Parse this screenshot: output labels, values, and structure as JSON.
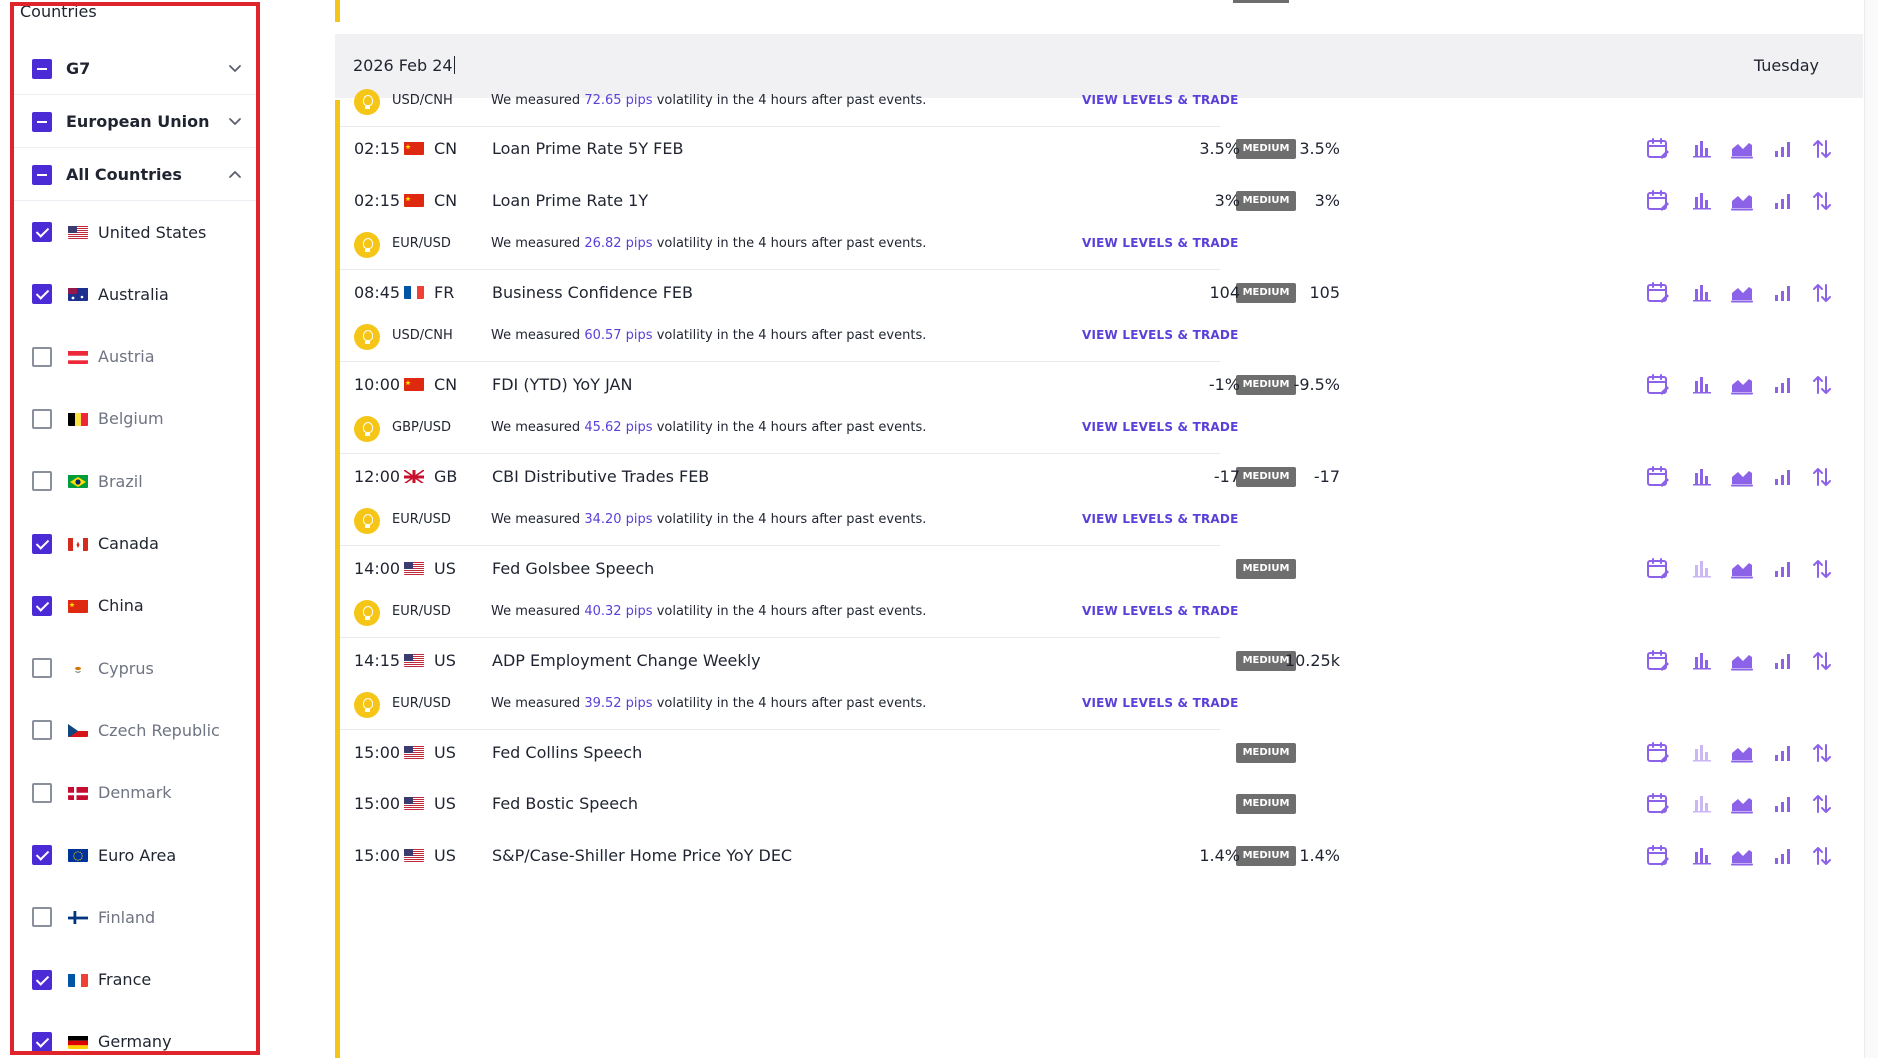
{
  "sidebar": {
    "title": "Countries",
    "groups": [
      {
        "label": "G7",
        "state": "partial",
        "chevron": "chevron-down-icon"
      },
      {
        "label": "European Union",
        "state": "partial",
        "chevron": "chevron-down-icon"
      },
      {
        "label": "All Countries",
        "state": "partial",
        "chevron": "chevron-up-icon"
      }
    ],
    "countries": [
      {
        "label": "United States",
        "checked": true,
        "flag": "us-flag-icon"
      },
      {
        "label": "Australia",
        "checked": true,
        "flag": "au-flag-icon"
      },
      {
        "label": "Austria",
        "checked": false,
        "flag": "at-flag-icon"
      },
      {
        "label": "Belgium",
        "checked": false,
        "flag": "be-flag-icon"
      },
      {
        "label": "Brazil",
        "checked": false,
        "flag": "br-flag-icon"
      },
      {
        "label": "Canada",
        "checked": true,
        "flag": "ca-flag-icon"
      },
      {
        "label": "China",
        "checked": true,
        "flag": "cn-flag-icon"
      },
      {
        "label": "Cyprus",
        "checked": false,
        "flag": "cy-flag-icon"
      },
      {
        "label": "Czech Republic",
        "checked": false,
        "flag": "cz-flag-icon"
      },
      {
        "label": "Denmark",
        "checked": false,
        "flag": "dk-flag-icon"
      },
      {
        "label": "Euro Area",
        "checked": true,
        "flag": "eu-flag-icon"
      },
      {
        "label": "Finland",
        "checked": false,
        "flag": "fi-flag-icon"
      },
      {
        "label": "France",
        "checked": true,
        "flag": "fr-flag-icon"
      },
      {
        "label": "Germany",
        "checked": true,
        "flag": "de-flag-icon"
      }
    ]
  },
  "calendar": {
    "date": "2026 Feb 24",
    "day": "Tuesday",
    "badge_label": "MEDIUM",
    "view_label": "VIEW LEVELS & TRADE",
    "vol_prefix": "We measured",
    "vol_suffix": "volatility in the 4 hours after past events.",
    "accent": "#5a3fd8",
    "highlight": "#f5c518",
    "rows": [
      {
        "kind": "info",
        "pair": "USD/CNH",
        "pips": "72.65 pips"
      },
      {
        "kind": "event",
        "time": "02:15",
        "country": "CN",
        "flag": "cn-flag-icon",
        "name": "Loan Prime Rate 5Y FEB",
        "actual": "3.5%",
        "previous": "3.5%",
        "bars_faded": false
      },
      {
        "kind": "event",
        "time": "02:15",
        "country": "CN",
        "flag": "cn-flag-icon",
        "name": "Loan Prime Rate 1Y",
        "actual": "3%",
        "previous": "3%",
        "bars_faded": false
      },
      {
        "kind": "info",
        "pair": "EUR/USD",
        "pips": "26.82 pips"
      },
      {
        "kind": "event",
        "time": "08:45",
        "country": "FR",
        "flag": "fr-flag-icon",
        "name": "Business Confidence FEB",
        "actual": "104",
        "previous": "105",
        "bars_faded": false
      },
      {
        "kind": "info",
        "pair": "USD/CNH",
        "pips": "60.57 pips"
      },
      {
        "kind": "event",
        "time": "10:00",
        "country": "CN",
        "flag": "cn-flag-icon",
        "name": "FDI (YTD) YoY JAN",
        "actual": "-1%",
        "previous": "-9.5%",
        "bars_faded": false
      },
      {
        "kind": "info",
        "pair": "GBP/USD",
        "pips": "45.62 pips"
      },
      {
        "kind": "event",
        "time": "12:00",
        "country": "GB",
        "flag": "gb-flag-icon",
        "name": "CBI Distributive Trades FEB",
        "actual": "-17",
        "previous": "-17",
        "bars_faded": false
      },
      {
        "kind": "info",
        "pair": "EUR/USD",
        "pips": "34.20 pips"
      },
      {
        "kind": "event",
        "time": "14:00",
        "country": "US",
        "flag": "us-flag-icon",
        "name": "Fed Golsbee Speech",
        "actual": "",
        "previous": "",
        "bars_faded": true
      },
      {
        "kind": "info",
        "pair": "EUR/USD",
        "pips": "40.32 pips"
      },
      {
        "kind": "event",
        "time": "14:15",
        "country": "US",
        "flag": "us-flag-icon",
        "name": "ADP Employment Change Weekly",
        "actual": "",
        "previous": "10.25k",
        "bars_faded": false
      },
      {
        "kind": "info",
        "pair": "EUR/USD",
        "pips": "39.52 pips"
      },
      {
        "kind": "event",
        "time": "15:00",
        "country": "US",
        "flag": "us-flag-icon",
        "name": "Fed Collins Speech",
        "actual": "",
        "previous": "",
        "bars_faded": true
      },
      {
        "kind": "event",
        "time": "15:00",
        "country": "US",
        "flag": "us-flag-icon",
        "name": "Fed Bostic Speech",
        "actual": "",
        "previous": "",
        "bars_faded": true
      },
      {
        "kind": "event",
        "time": "15:00",
        "country": "US",
        "flag": "us-flag-icon",
        "name": "S&P/Case-Shiller Home Price YoY DEC",
        "actual": "1.4%",
        "previous": "1.4%",
        "bars_faded": false
      }
    ],
    "row_icons": [
      "calendar-edit-icon",
      "bar-chart-icon",
      "area-chart-icon",
      "column-chart-icon",
      "sort-arrows-icon"
    ]
  }
}
